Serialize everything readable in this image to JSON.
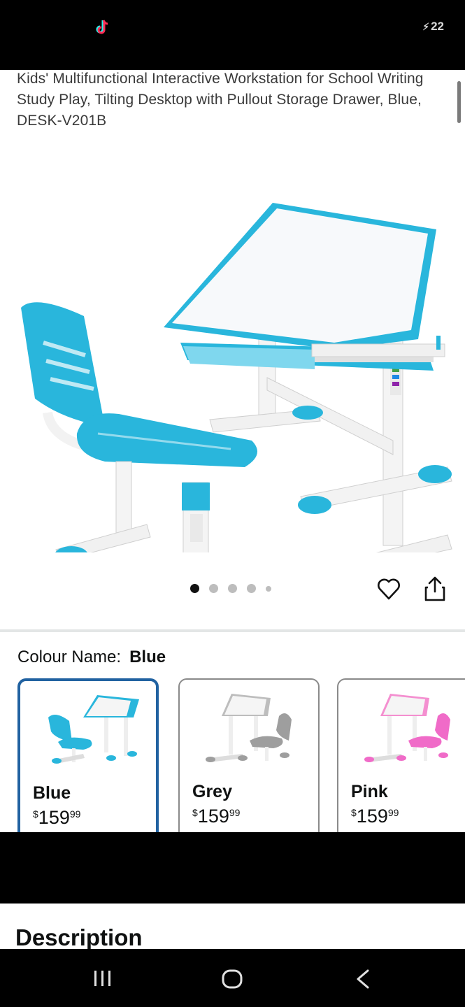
{
  "status_bar": {
    "battery_text": "22",
    "app_icon": "tiktok-icon",
    "charging_icon": "bolt-icon"
  },
  "product": {
    "title": "Kids' Multifunctional Interactive Workstation for School Writing Study Play, Tilting Desktop with Pullout Storage Drawer, Blue, DESK-V201B",
    "image_count": 5,
    "active_image_index": 0
  },
  "actions": {
    "favorite_icon": "heart-icon",
    "share_icon": "share-icon"
  },
  "variant": {
    "label": "Colour Name:",
    "selected": "Blue",
    "options": [
      {
        "name": "Blue",
        "currency": "$",
        "whole": "159",
        "fraction": "99",
        "color": "#29b6dc"
      },
      {
        "name": "Grey",
        "currency": "$",
        "whole": "159",
        "fraction": "99",
        "color": "#9e9e9e"
      },
      {
        "name": "Pink",
        "currency": "$",
        "whole": "159",
        "fraction": "99",
        "color": "#f06bc8"
      }
    ]
  },
  "description": {
    "heading": "Description"
  },
  "nav": {
    "recents_icon": "recents-icon",
    "home_icon": "home-icon",
    "back_icon": "back-icon"
  },
  "colors": {
    "accent": "#2162a1",
    "desk_blue": "#29b6dc"
  }
}
